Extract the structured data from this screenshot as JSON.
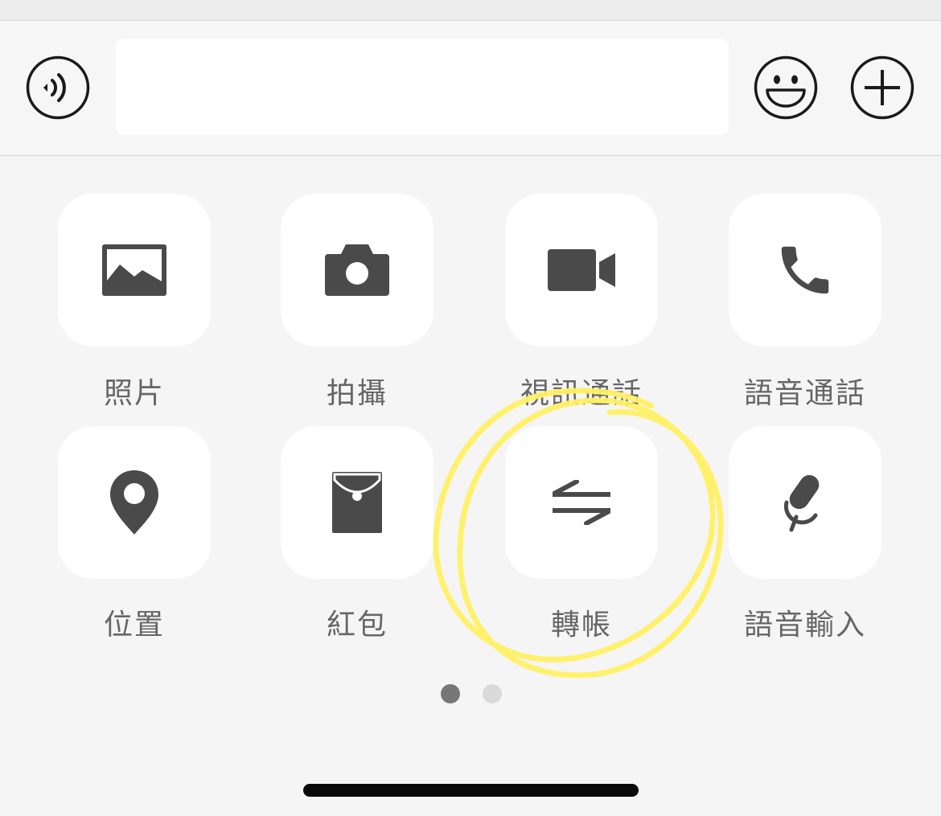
{
  "input_bar": {
    "voice_icon": "voice-input-icon",
    "text_value": "",
    "emoji_icon": "emoji-icon",
    "plus_icon": "plus-icon"
  },
  "actions": [
    {
      "label": "照片",
      "icon": "photo-icon"
    },
    {
      "label": "拍攝",
      "icon": "camera-icon"
    },
    {
      "label": "視訊通話",
      "icon": "video-call-icon"
    },
    {
      "label": "語音通話",
      "icon": "phone-icon"
    },
    {
      "label": "位置",
      "icon": "location-pin-icon"
    },
    {
      "label": "紅包",
      "icon": "red-envelope-icon"
    },
    {
      "label": "轉帳",
      "icon": "transfer-arrows-icon"
    },
    {
      "label": "語音輸入",
      "icon": "microphone-icon"
    }
  ],
  "pager": {
    "pages": 2,
    "active_page": 1
  },
  "annotation": {
    "highlight_target": "轉帳",
    "color": "#fff064"
  },
  "colors": {
    "icon": "#4a4a4a",
    "label": "#666666",
    "dot_active": "#777777",
    "dot_inactive": "#d9d9d9"
  }
}
